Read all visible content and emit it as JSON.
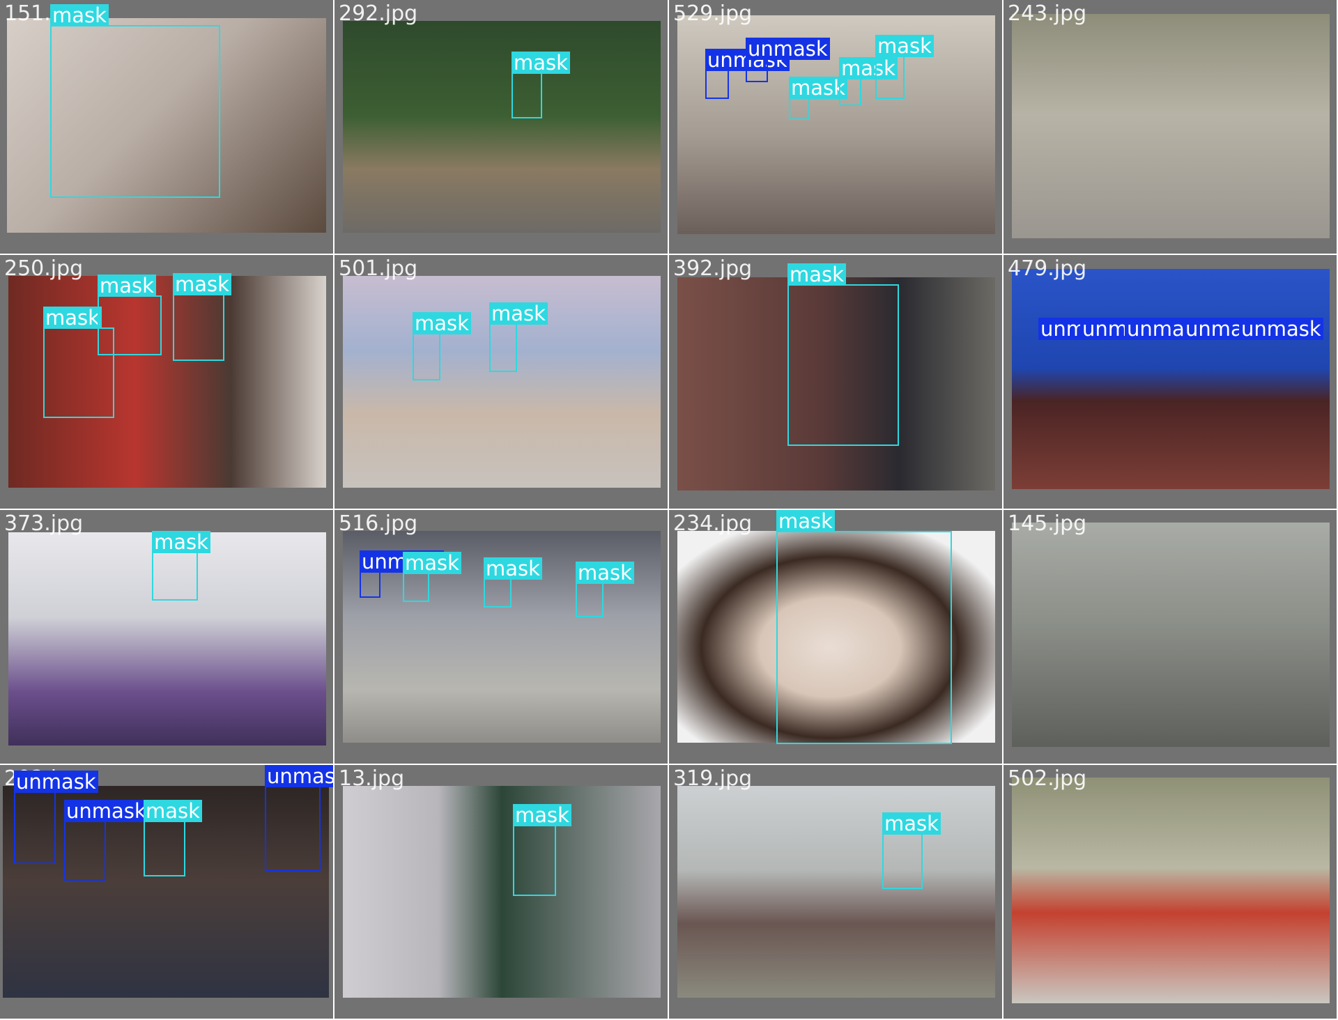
{
  "tiles": [
    {
      "name": "151.jpg",
      "bg": "linear-gradient(135deg,#d7cfc8 0%,#b9aea6 45%,#5b4a3e 100%)",
      "boxes": [
        {
          "label": "mask",
          "cls": "mask"
        }
      ]
    },
    {
      "name": "292.jpg",
      "bg": "linear-gradient(180deg,#2e4a2c 0%,#3d5f33 45%,#8a7a62 70%,#6d6a66 100%)",
      "boxes": [
        {
          "label": "mask",
          "cls": "mask"
        }
      ]
    },
    {
      "name": "529.jpg",
      "bg": "linear-gradient(180deg,#cfc9bf 0%,#a49c92 55%,#6b5f5a 100%)",
      "boxes": [
        {
          "label": "unmask",
          "cls": "unmask"
        },
        {
          "label": "unmask",
          "cls": "unmask"
        },
        {
          "label": "mask",
          "cls": "mask"
        },
        {
          "label": "mask",
          "cls": "mask"
        },
        {
          "label": "mask",
          "cls": "mask"
        }
      ]
    },
    {
      "name": "243.jpg",
      "bg": "linear-gradient(180deg,#8e8d7a 0%,#b7b3a6 45%,#9a9690 100%)",
      "boxes": []
    },
    {
      "name": "250.jpg",
      "bg": "linear-gradient(90deg,#6e2a22 0%,#b8362f 40%,#4a3a33 70%,#d9d2cc 100%)",
      "boxes": [
        {
          "label": "mask",
          "cls": "mask"
        },
        {
          "label": "mask",
          "cls": "mask"
        },
        {
          "label": "mask",
          "cls": "mask"
        }
      ]
    },
    {
      "name": "501.jpg",
      "bg": "linear-gradient(180deg,#c7bdd0 0%,#a3b1cf 35%,#c9b8a9 65%,#c8c2bd 100%)",
      "boxes": [
        {
          "label": "mask",
          "cls": "mask"
        },
        {
          "label": "mask",
          "cls": "mask"
        }
      ]
    },
    {
      "name": "392.jpg",
      "bg": "linear-gradient(90deg,#7a5048 0%,#5a3a38 45%,#2a2a30 70%,#6c6a64 100%)",
      "boxes": [
        {
          "label": "mask",
          "cls": "mask"
        }
      ]
    },
    {
      "name": "479.jpg",
      "bg": "linear-gradient(180deg,#2a54c8 0%,#1f46b0 45%,#4a2424 60%,#7c3e36 100%)",
      "boxes": [
        {
          "label": "unmask",
          "cls": "unmask"
        },
        {
          "label": "unmask",
          "cls": "unmask"
        },
        {
          "label": "unmask",
          "cls": "unmask"
        },
        {
          "label": "unmask",
          "cls": "unmask"
        },
        {
          "label": "unmask",
          "cls": "unmask"
        }
      ]
    },
    {
      "name": "373.jpg",
      "bg": "linear-gradient(180deg,#e8e8ec 0%,#cfd0d6 40%,#6b4f8c 75%,#40305a 100%)",
      "boxes": [
        {
          "label": "mask",
          "cls": "mask"
        }
      ]
    },
    {
      "name": "516.jpg",
      "bg": "linear-gradient(180deg,#5a5c66 0%,#9da0a8 40%,#b7b6b0 75%,#8f8d89 100%)",
      "boxes": [
        {
          "label": "unmask",
          "cls": "unmask"
        },
        {
          "label": "mask",
          "cls": "mask"
        },
        {
          "label": "mask",
          "cls": "mask"
        },
        {
          "label": "mask",
          "cls": "mask"
        }
      ]
    },
    {
      "name": "234.jpg",
      "bg": "radial-gradient(ellipse at 48% 55%,#e9ddd4 0%,#d8c6b8 30%,#3a2a22 55%,#f1f1f1 80%)",
      "boxes": [
        {
          "label": "mask",
          "cls": "mask"
        }
      ]
    },
    {
      "name": "145.jpg",
      "bg": "linear-gradient(180deg,#a9aca6 0%,#8b8f88 45%,#5d605b 100%)",
      "boxes": []
    },
    {
      "name": "202.jpg",
      "bg": "linear-gradient(180deg,#2d2624 0%,#4b3e3a 45%,#2f3342 100%)",
      "boxes": [
        {
          "label": "unmask",
          "cls": "unmask"
        },
        {
          "label": "unmask",
          "cls": "unmask"
        },
        {
          "label": "mask",
          "cls": "mask"
        },
        {
          "label": "unmask",
          "cls": "unmask"
        }
      ]
    },
    {
      "name": "13.jpg",
      "bg": "linear-gradient(90deg,#cfcdd1 0%,#b8b6bb 30%,#2c4638 50%,#a9a7ac 100%)",
      "boxes": [
        {
          "label": "mask",
          "cls": "mask"
        }
      ]
    },
    {
      "name": "319.jpg",
      "bg": "linear-gradient(180deg,#cdd0d2 0%,#b4b7b6 40%,#6a5652 65%,#8a8a7e 100%)",
      "boxes": [
        {
          "label": "mask",
          "cls": "mask"
        }
      ]
    },
    {
      "name": "502.jpg",
      "bg": "linear-gradient(180deg,#8f9176 0%,#b9b8a4 40%,#c4412f 60%,#c9c7c0 100%)",
      "boxes": []
    }
  ]
}
